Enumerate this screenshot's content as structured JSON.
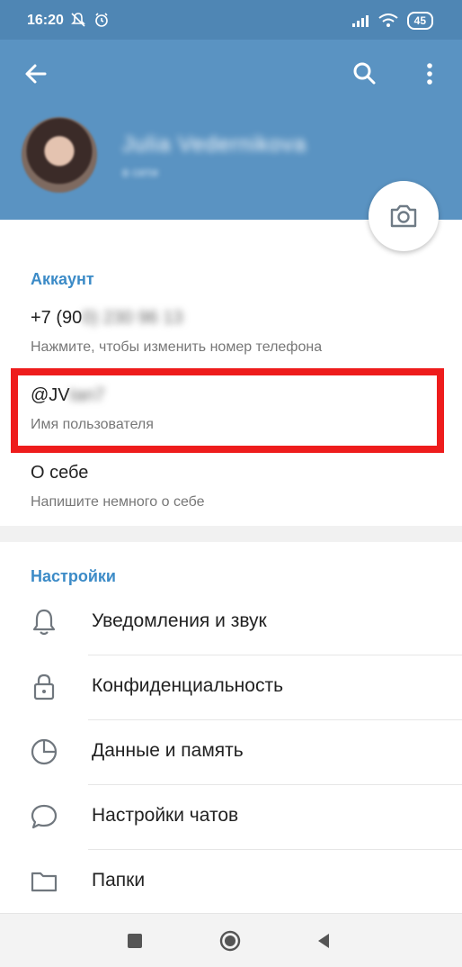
{
  "status_bar": {
    "time": "16:20",
    "battery": "45"
  },
  "header": {
    "name": "Julia Vedernikova",
    "status": "в сети"
  },
  "account": {
    "title": "Аккаунт",
    "phone": "+7 (90",
    "phone_hidden": "0) 230 96 13",
    "phone_hint": "Нажмите, чтобы изменить номер телефона",
    "username": "@JV",
    "username_hidden": "tan7",
    "username_hint": "Имя пользователя",
    "bio": "О себе",
    "bio_hint": "Напишите немного о себе"
  },
  "settings": {
    "title": "Настройки",
    "items": [
      {
        "label": "Уведомления и звук",
        "icon": "bell-icon"
      },
      {
        "label": "Конфиденциальность",
        "icon": "lock-icon"
      },
      {
        "label": "Данные и память",
        "icon": "pie-chart-icon"
      },
      {
        "label": "Настройки чатов",
        "icon": "chat-bubble-icon"
      },
      {
        "label": "Папки",
        "icon": "folder-icon"
      }
    ]
  },
  "colors": {
    "header": "#5a93c2",
    "accent": "#3c8bc7",
    "highlight": "#ee1c1c"
  }
}
